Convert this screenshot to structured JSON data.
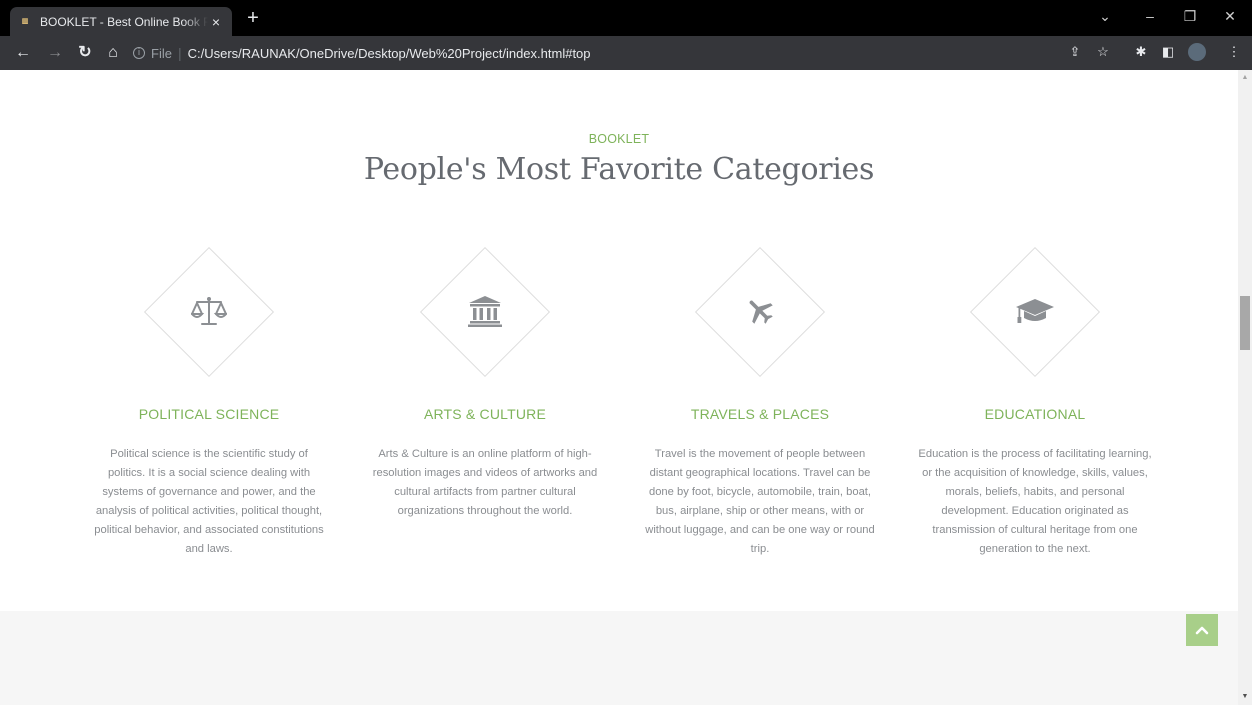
{
  "browser": {
    "tab_title": "BOOKLET - Best Online Book Reading",
    "tab_close": "×",
    "new_tab": "+",
    "file_label": "File",
    "url": "C:/Users/RAUNAK/OneDrive/Desktop/Web%20Project/index.html#top"
  },
  "section": {
    "eyebrow": "BOOKLET",
    "heading": "People's Most Favorite Categories"
  },
  "categories": [
    {
      "icon": "balance-scale-icon",
      "title": "POLITICAL SCIENCE",
      "description": "Political science is the scientific study of politics. It is a social science dealing with systems of governance and power, and the analysis of political activities, political thought, political behavior, and associated constitutions and laws."
    },
    {
      "icon": "university-icon",
      "title": "ARTS & CULTURE",
      "description": "Arts & Culture is an online platform of high-resolution images and videos of artworks and cultural artifacts from partner cultural organizations throughout the world."
    },
    {
      "icon": "plane-icon",
      "title": "TRAVELS & PLACES",
      "description": "Travel is the movement of people between distant geographical locations. Travel can be done by foot, bicycle, automobile, train, boat, bus, airplane, ship or other means, with or without luggage, and can be one way or round trip."
    },
    {
      "icon": "graduation-cap-icon",
      "title": "EDUCATIONAL",
      "description": "Education is the process of facilitating learning, or the acquisition of knowledge, skills, values, morals, beliefs, habits, and personal development. Education originated as transmission of cultural heritage from one generation to the next."
    }
  ],
  "colors": {
    "accent": "#7eb35a",
    "heading": "#666a70",
    "body_text": "#8a8d91",
    "back_to_top": "#a8cf89"
  }
}
